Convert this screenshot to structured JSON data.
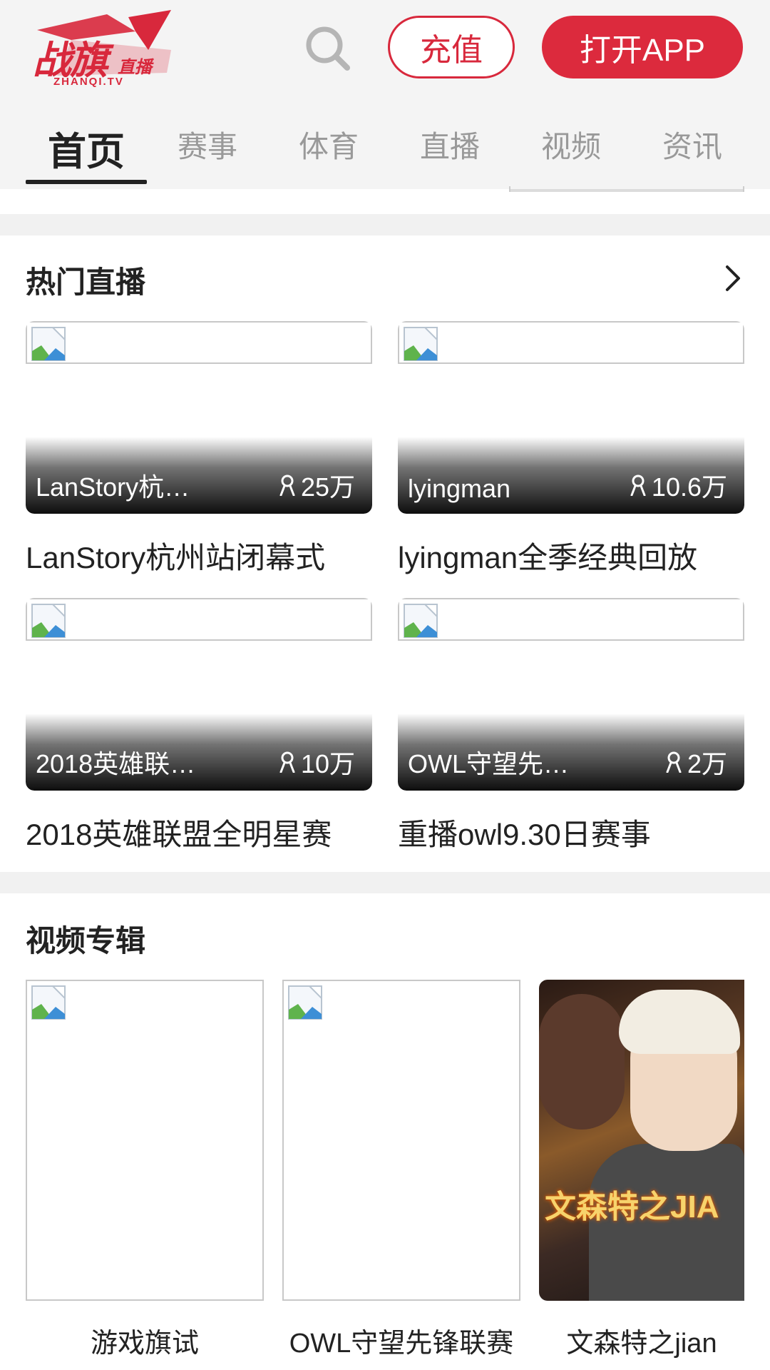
{
  "header": {
    "logo": {
      "main": "战旗",
      "sub": "直播",
      "domain": "ZHANQI.TV"
    },
    "recharge_label": "充值",
    "open_app_label": "打开APP"
  },
  "nav": {
    "tabs": [
      {
        "label": "首页",
        "active": true
      },
      {
        "label": "赛事",
        "active": false
      },
      {
        "label": "体育",
        "active": false
      },
      {
        "label": "直播",
        "active": false
      },
      {
        "label": "视频",
        "active": false
      },
      {
        "label": "资讯",
        "active": false
      }
    ]
  },
  "hot_live": {
    "title": "热门直播",
    "items": [
      {
        "streamer": "LanStory杭…",
        "viewers": "25万",
        "title": "LanStory杭州站闭幕式"
      },
      {
        "streamer": "lyingman",
        "viewers": "10.6万",
        "title": "lyingman全季经典回放"
      },
      {
        "streamer": "2018英雄联…",
        "viewers": "10万",
        "title": "2018英雄联盟全明星赛"
      },
      {
        "streamer": "OWL守望先…",
        "viewers": "2万",
        "title": "重播owl9.30日赛事"
      }
    ]
  },
  "video_albums": {
    "title": "视频专辑",
    "items": [
      {
        "caption": "游戏旗试"
      },
      {
        "caption": "OWL守望先锋联赛"
      },
      {
        "caption": "文森特之jian",
        "image_text": "文森特之JIA"
      }
    ]
  },
  "colors": {
    "brand_red": "#dc2a3d",
    "divider": "#f1f1f1",
    "muted_text": "#999999"
  }
}
